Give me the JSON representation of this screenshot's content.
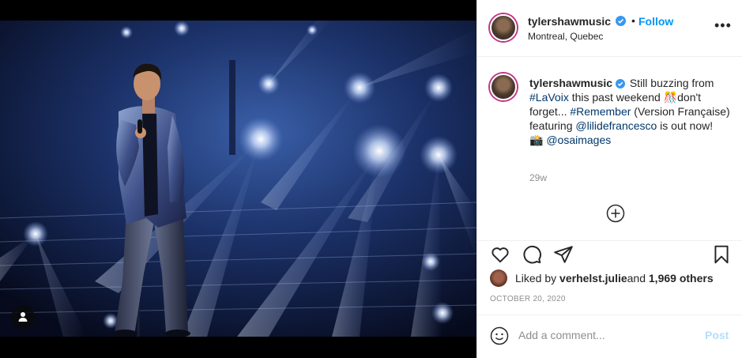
{
  "post": {
    "username": "tylershawmusic",
    "follow_label": "Follow",
    "separator": "•",
    "location": "Montreal, Quebec",
    "more_label": "•••",
    "caption": {
      "username": "tylershawmusic",
      "part1": " Still buzzing from ",
      "tag1": "#LaVoix",
      "part2": " this past weekend ",
      "emoji1": "🎊",
      "part3": "don't forget... ",
      "tag2": "#Remember",
      "part4": " (Version Française) featuring ",
      "mention1": "@lilidefrancesco",
      "part5": " is out now!",
      "emoji2": "📸",
      "mention2": "@osaimages"
    },
    "time_ago": "29w",
    "liked_by_prefix": "Liked by ",
    "liked_by_user": "verhelst.julie",
    "liked_by_and": " and ",
    "liked_by_others": "1,969 others",
    "date": "OCTOBER 20, 2020",
    "comment_placeholder": "Add a comment...",
    "post_label": "Post"
  },
  "icons": {
    "verified": "verified-badge-icon",
    "user_tag": "user-tag-icon",
    "load_more": "plus-circle-icon",
    "like": "heart-icon",
    "comment": "comment-icon",
    "share": "paper-plane-icon",
    "save": "bookmark-icon",
    "emoji": "smiley-icon"
  },
  "colors": {
    "link_blue": "#0095f6",
    "tag_blue": "#00376b",
    "post_disabled": "#b2dffc",
    "muted": "#8e8e8e"
  }
}
